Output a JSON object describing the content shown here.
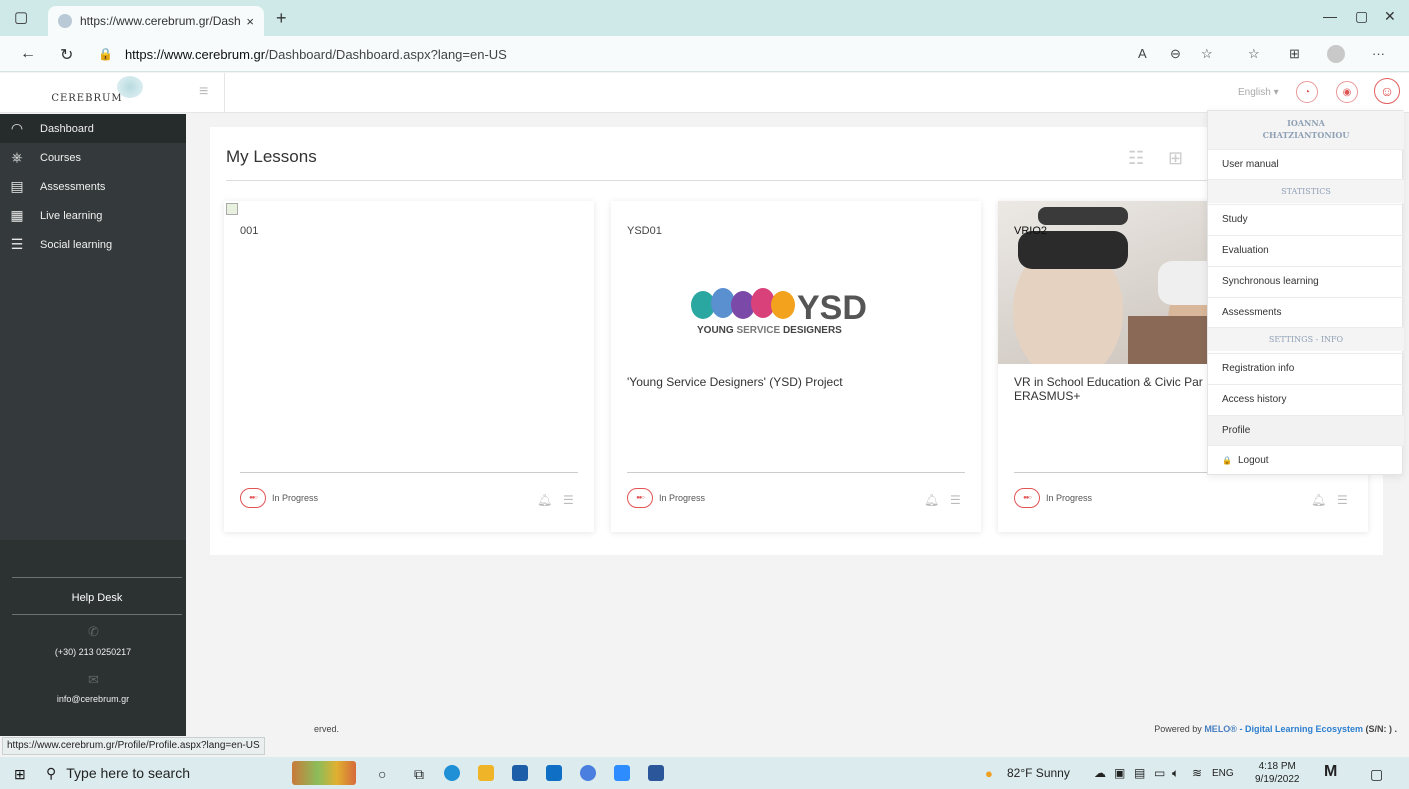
{
  "browser": {
    "tab_title": "https://www.cerebrum.gr/Dashb",
    "tab_close": "×",
    "new_tab": "+",
    "url_host": "https://www.cerebrum.gr",
    "url_path": "/Dashboard/Dashboard.aspx?lang=en-US",
    "more": "···"
  },
  "header": {
    "logo_text": "CEREBRUM",
    "language": "English ▾"
  },
  "sidebar": {
    "items": [
      {
        "label": "Dashboard",
        "icon": "dashboard-icon"
      },
      {
        "label": "Courses",
        "icon": "courses-icon"
      },
      {
        "label": "Assessments",
        "icon": "assessments-icon"
      },
      {
        "label": "Live learning",
        "icon": "live-learning-icon"
      },
      {
        "label": "Social learning",
        "icon": "social-learning-icon"
      }
    ],
    "help_title": "Help Desk",
    "phone": "(+30) 213 0250217",
    "email": "info@cerebrum.gr"
  },
  "main": {
    "title": "My Lessons",
    "cards": [
      {
        "code": "001",
        "title": "",
        "status": "In Progress"
      },
      {
        "code": "YSD01",
        "title": "'Young Service Designers' (YSD) Project",
        "status": "In Progress",
        "logo_big": "YSD",
        "logo_sub_a": "YOUNG",
        "logo_sub_b": " SERVICE ",
        "logo_sub_c": "DESIGNERS"
      },
      {
        "code": "VRIO2",
        "title": "VR in School Education & Civic Par\nERASMUS+",
        "status": "In Progress"
      }
    ]
  },
  "dropdown": {
    "user_name": "IOANNA\nCHATZIANTONIOU",
    "user_manual": "User manual",
    "statistics_head": "STATISTICS",
    "study": "Study",
    "evaluation": "Evaluation",
    "synchronous": "Synchronous learning",
    "assessments": "Assessments",
    "settings_head": "SETTINGS - INFO",
    "registration": "Registration info",
    "access_history": "Access history",
    "profile": "Profile",
    "logout": "Logout"
  },
  "footer": {
    "rights": "erved.",
    "powered_by": "Powered by ",
    "melo": "MELO®",
    "dash": " - ",
    "dle": "Digital Learning Ecosystem",
    "sn": " (S/N: ) ."
  },
  "status_url": "https://www.cerebrum.gr/Profile/Profile.aspx?lang=en-US",
  "taskbar": {
    "search_placeholder": "Type here to search",
    "weather": "82°F  Sunny",
    "lang": "ENG",
    "time": "4:18 PM",
    "date": "9/19/2022"
  },
  "colors": {
    "sidebar_bg": "#343a3b",
    "accent_red": "#e25454",
    "tab_strip": "#cfe9e9"
  }
}
